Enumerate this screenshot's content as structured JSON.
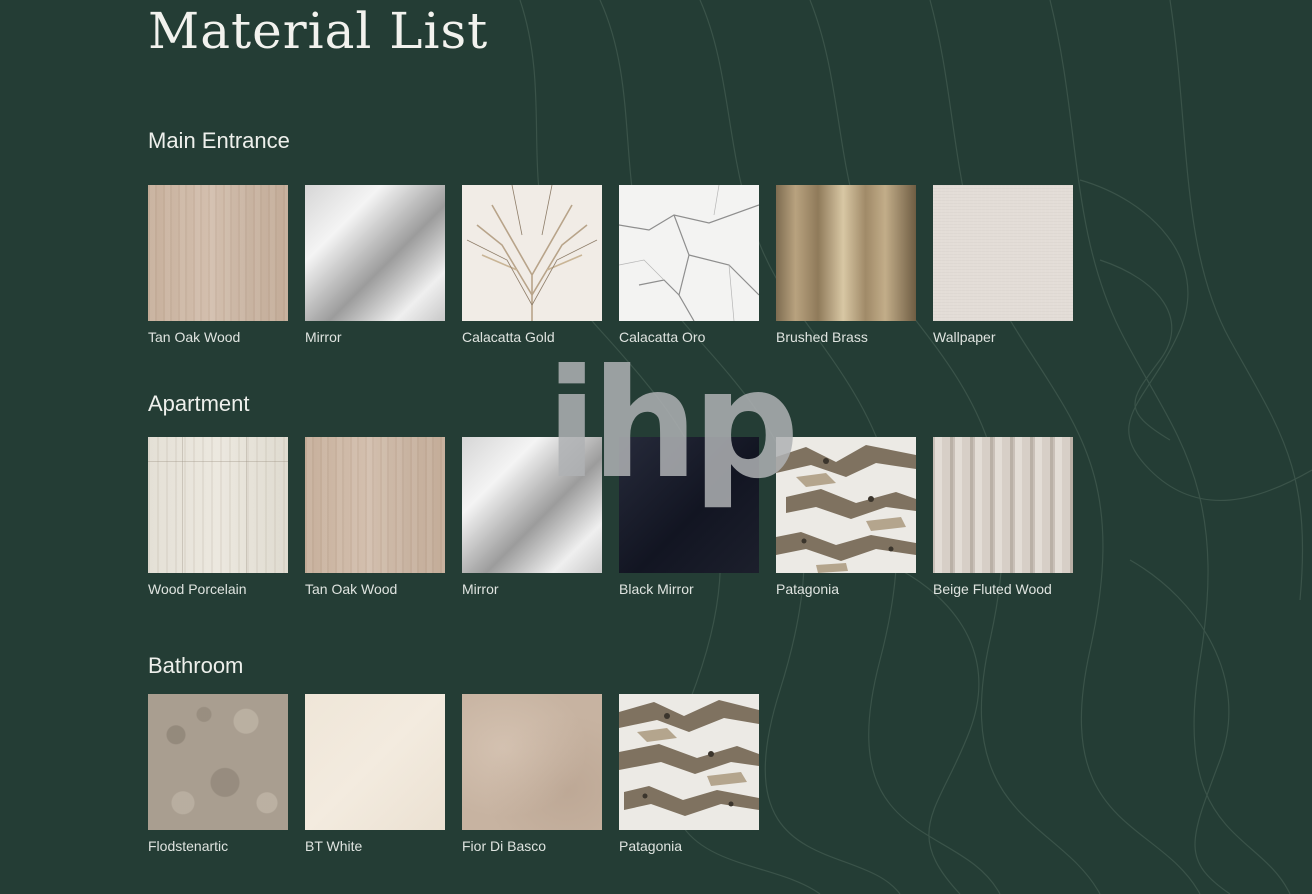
{
  "title": "Material List",
  "watermark": "ihp",
  "sections": [
    {
      "title": "Main Entrance",
      "items": [
        {
          "label": "Tan Oak Wood"
        },
        {
          "label": "Mirror"
        },
        {
          "label": "Calacatta Gold"
        },
        {
          "label": "Calacatta Oro"
        },
        {
          "label": "Brushed Brass"
        },
        {
          "label": "Wallpaper"
        }
      ]
    },
    {
      "title": "Apartment",
      "items": [
        {
          "label": "Wood Porcelain"
        },
        {
          "label": "Tan Oak Wood"
        },
        {
          "label": "Mirror"
        },
        {
          "label": "Black Mirror"
        },
        {
          "label": "Patagonia"
        },
        {
          "label": "Beige Fluted Wood"
        }
      ]
    },
    {
      "title": "Bathroom",
      "items": [
        {
          "label": "Flodstenartic"
        },
        {
          "label": "BT White"
        },
        {
          "label": "Fior Di Basco"
        },
        {
          "label": "Patagonia"
        }
      ]
    }
  ],
  "colors": {
    "background": "#243d35",
    "text": "#e9ece9",
    "contour": "#3a5349"
  }
}
